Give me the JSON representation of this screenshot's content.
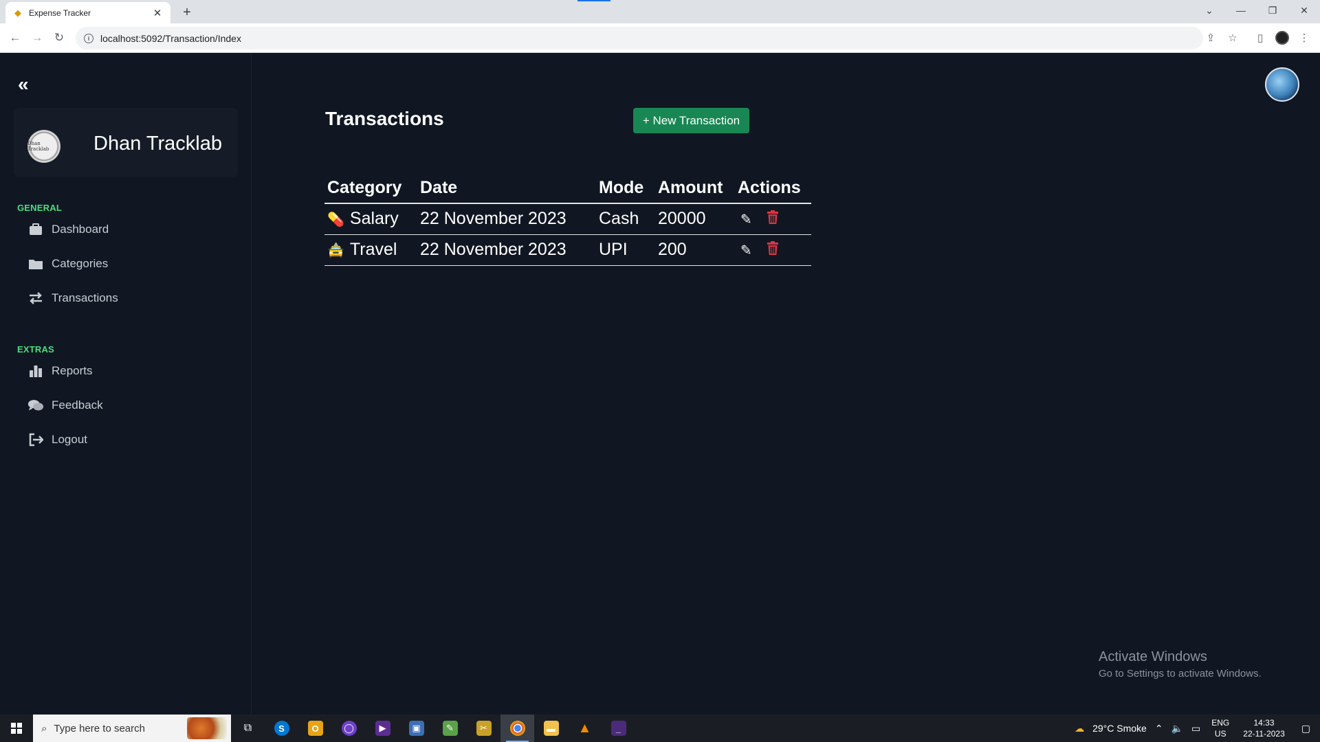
{
  "browser": {
    "tab_title": "Expense Tracker",
    "tab_close": "✕",
    "new_tab": "+",
    "url": "localhost:5092/Transaction/Index"
  },
  "sidebar": {
    "collapse_icon": "«",
    "brand_name": "Dhan Tracklab",
    "brand_logo_text": "Dhan Tracklab",
    "sections": [
      {
        "header": "GENERAL",
        "items": [
          {
            "label": "Dashboard",
            "icon": "dashboard-icon"
          },
          {
            "label": "Categories",
            "icon": "folder-icon"
          },
          {
            "label": "Transactions",
            "icon": "transfer-icon"
          }
        ]
      },
      {
        "header": "EXTRAS",
        "items": [
          {
            "label": "Reports",
            "icon": "bar-chart-icon"
          },
          {
            "label": "Feedback",
            "icon": "comments-icon"
          },
          {
            "label": "Logout",
            "icon": "logout-icon"
          }
        ]
      }
    ]
  },
  "main": {
    "title": "Transactions",
    "new_button": "+ New Transaction",
    "table": {
      "headers": [
        "Category",
        "Date",
        "Mode",
        "Amount",
        "Actions"
      ],
      "rows": [
        {
          "icon": "💊",
          "category": "Salary",
          "date": "22 November 2023",
          "mode": "Cash",
          "amount": "20000"
        },
        {
          "icon": "🚖",
          "category": "Travel",
          "date": "22 November 2023",
          "mode": "UPI",
          "amount": "200"
        }
      ]
    }
  },
  "watermark": {
    "title": "Activate Windows",
    "subtitle": "Go to Settings to activate Windows."
  },
  "taskbar": {
    "search_placeholder": "Type here to search",
    "weather": "29°C  Smoke",
    "lang_top": "ENG",
    "lang_bottom": "US",
    "time": "14:33",
    "date": "22-11-2023"
  },
  "colors": {
    "background": "#101722",
    "accent_green": "#198754",
    "section_header": "#4ade80",
    "delete_red": "#dc3545"
  }
}
